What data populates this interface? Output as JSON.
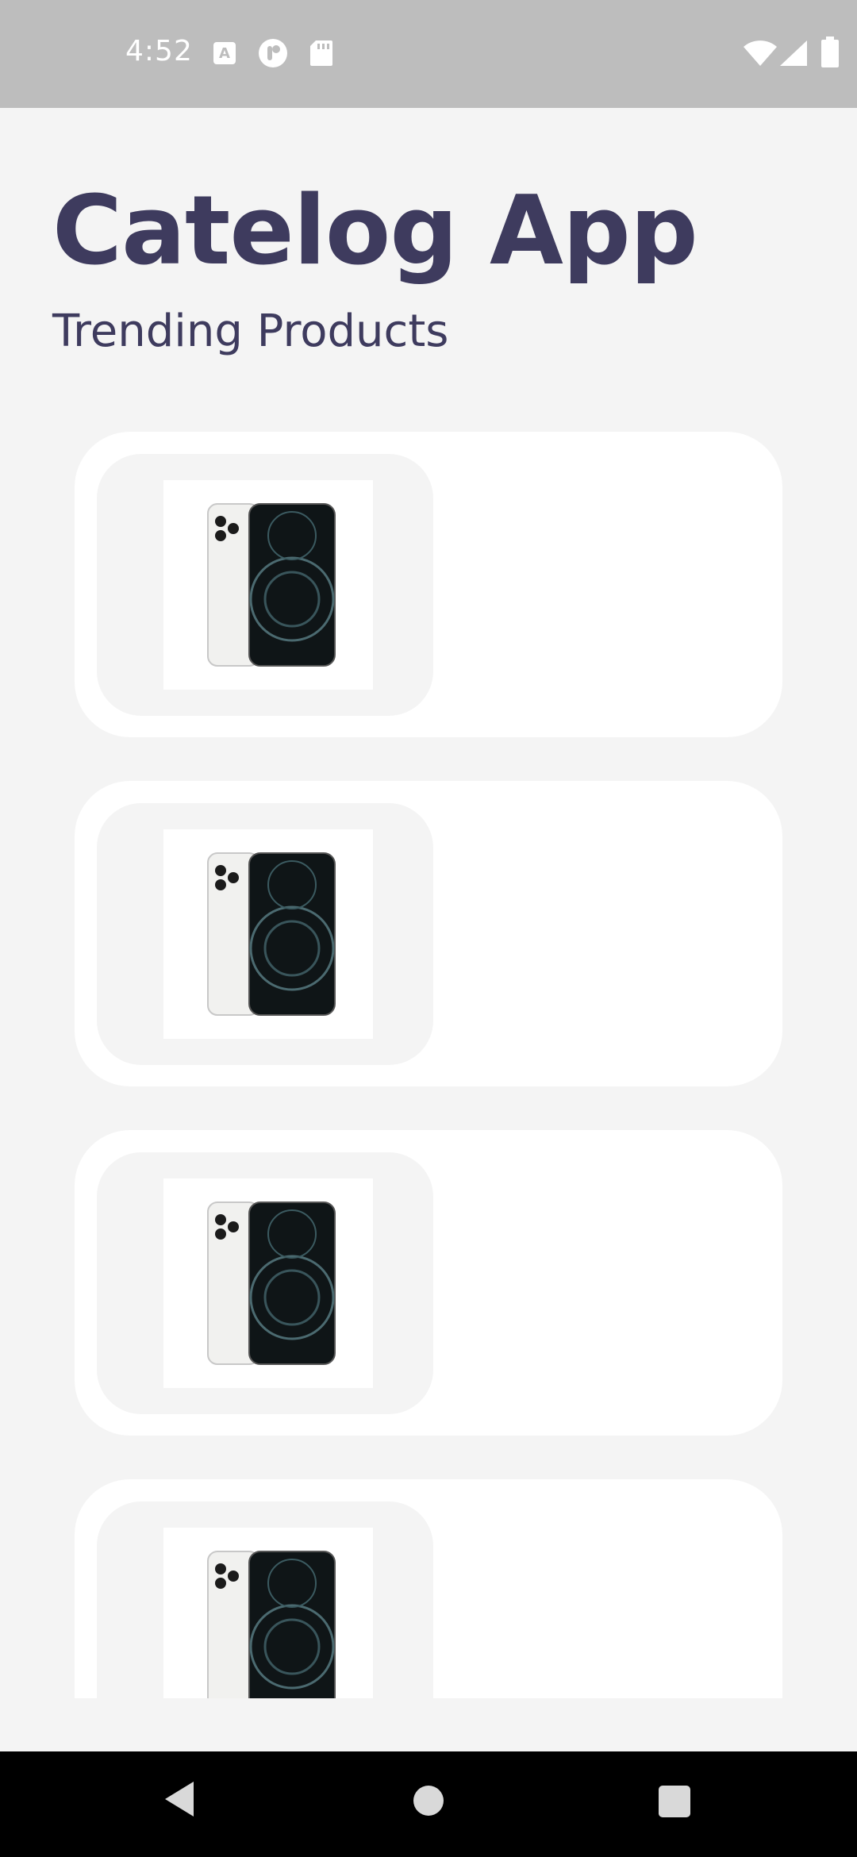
{
  "status_bar": {
    "time": "4:52",
    "left_icons": [
      "a-notification-icon",
      "tiktok-style-icon",
      "sd-card-icon"
    ],
    "right_icons": [
      "wifi-icon",
      "signal-icon",
      "battery-icon"
    ]
  },
  "header": {
    "title": "Catelog App",
    "subtitle": "Trending Products"
  },
  "products": [
    {
      "image_icon": "iphone-12-pro-image"
    },
    {
      "image_icon": "iphone-12-pro-image"
    },
    {
      "image_icon": "iphone-12-pro-image"
    },
    {
      "image_icon": "iphone-12-pro-image"
    }
  ],
  "nav_bar": {
    "buttons": [
      "back-icon",
      "home-icon",
      "recents-icon"
    ]
  },
  "colors": {
    "title": "#3e3b5e",
    "background": "#f4f4f4",
    "card": "#ffffff",
    "status_bar": "#bdbdbd",
    "nav_bar": "#000000"
  }
}
